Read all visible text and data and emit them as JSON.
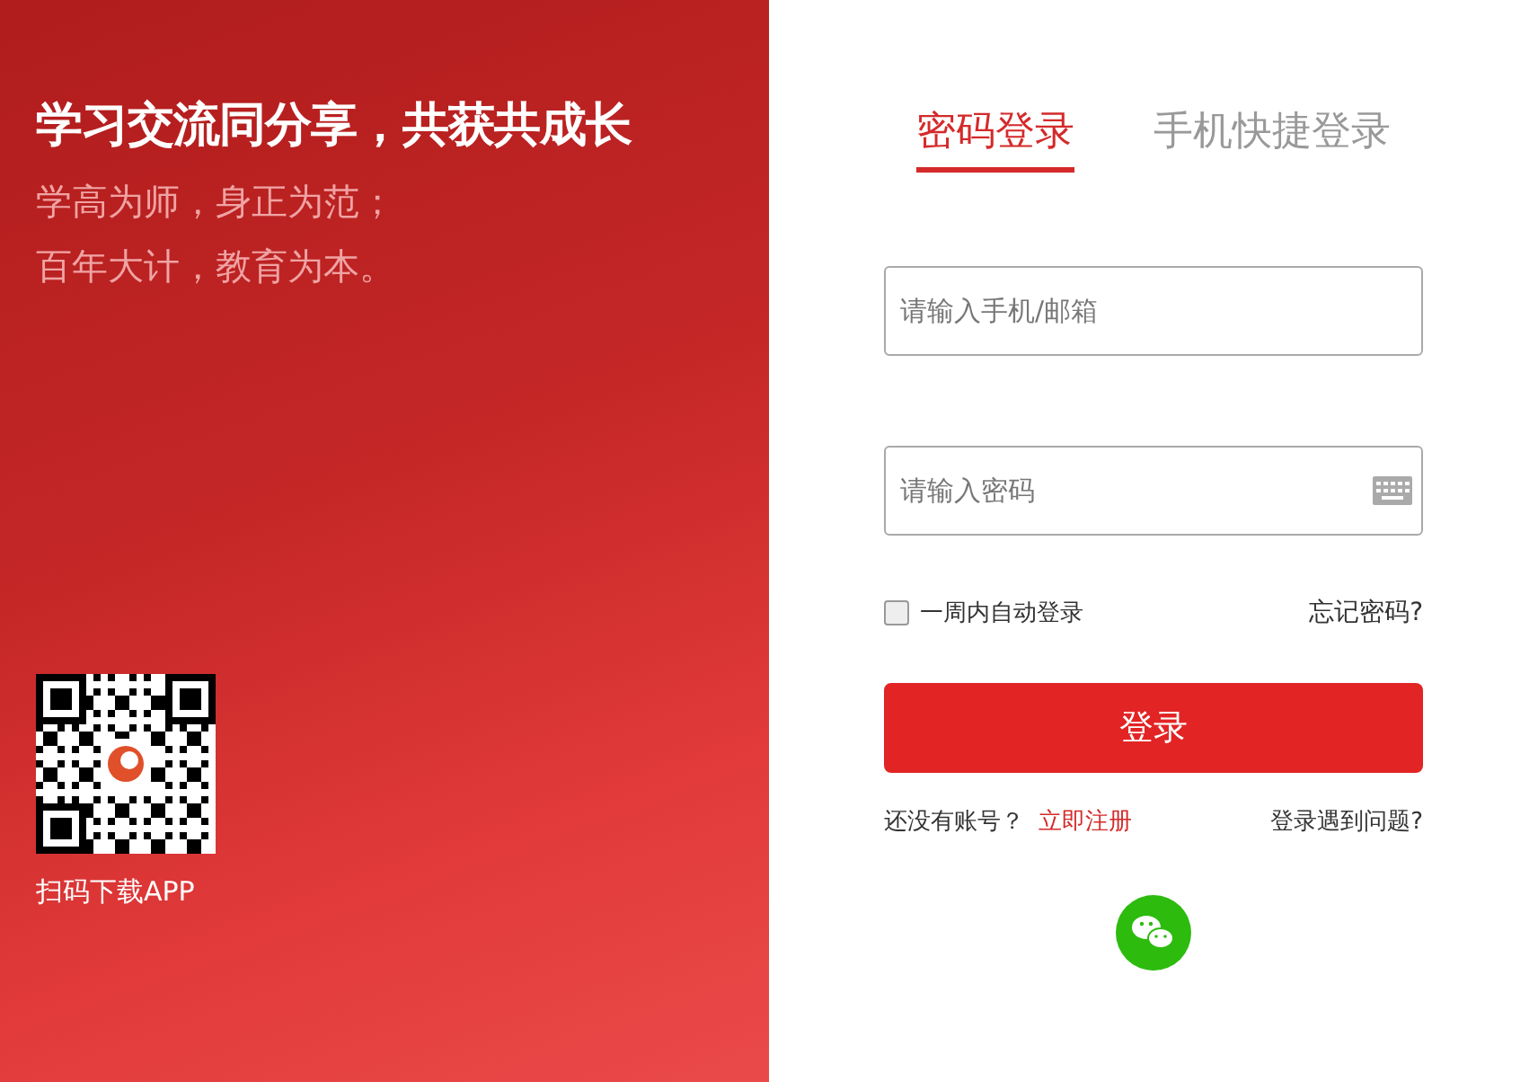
{
  "hero": {
    "title": "学习交流同分享，共获共成长",
    "lines": [
      "学高为师，身正为范；",
      "百年大计，教育为本。"
    ],
    "qr_caption": "扫码下载APP"
  },
  "tabs": [
    {
      "label": "密码登录",
      "selected": true
    },
    {
      "label": "手机快捷登录",
      "selected": false
    }
  ],
  "fields": [
    {
      "placeholder": "请输入手机/邮箱",
      "kind": "text"
    },
    {
      "placeholder": "请输入密码",
      "kind": "password"
    }
  ],
  "remember": {
    "label": "一周内自动登录",
    "checked": false
  },
  "forgot": "忘记密码?",
  "login_button": "登录",
  "register": {
    "prompt": "还没有账号？",
    "link": "立即注册"
  },
  "help": "登录遇到问题?"
}
